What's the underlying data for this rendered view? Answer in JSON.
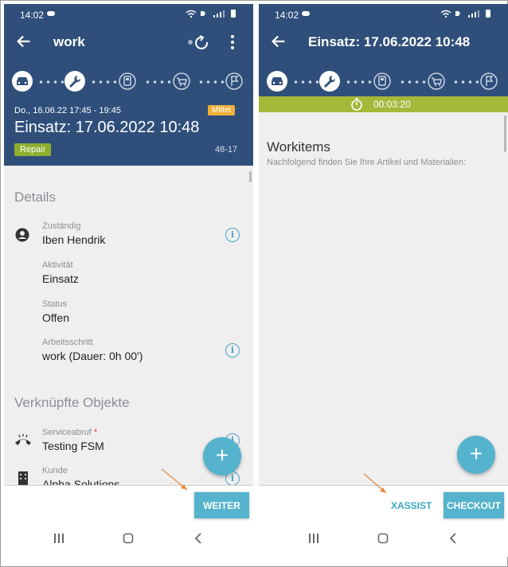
{
  "left": {
    "status": {
      "time": "14:02"
    },
    "appbar": {
      "title": "work"
    },
    "header": {
      "date_range": "Do., 16.06.22 17:45 - 19:45",
      "priority": "Mittel",
      "title": "Einsatz: 17.06.2022 10:48",
      "type_badge": "Repair",
      "code": "48-17"
    },
    "details": {
      "heading": "Details",
      "fields": [
        {
          "label": "Zuständig",
          "value": "Iben Hendrik"
        },
        {
          "label": "Aktivität",
          "value": "Einsatz"
        },
        {
          "label": "Status",
          "value": "Offen"
        },
        {
          "label": "Arbeitsschritt",
          "value": "work (Dauer: 0h 00')"
        }
      ]
    },
    "linked": {
      "heading": "Verknüpfte Objekte",
      "fields": [
        {
          "label": "Serviceabruf",
          "required_mark": "*",
          "value": "Testing FSM"
        },
        {
          "label": "Kunde",
          "value": "Alpha Solutions"
        }
      ]
    },
    "fab": "+",
    "actions": {
      "weiter": "WEITER"
    }
  },
  "right": {
    "status": {
      "time": "14:02"
    },
    "appbar": {
      "title": "Einsatz: 17.06.2022 10:48"
    },
    "timer": "00:03:20",
    "workitems": {
      "heading": "Workitems",
      "subtitle": "Nachfolgend finden Sie Ihre Artikel und Materialien:"
    },
    "fab": "+",
    "actions": {
      "xassist": "XASSIST",
      "checkout": "CHECKOUT"
    }
  },
  "colors": {
    "header_blue": "#2f4f7a",
    "accent_cyan": "#55b3cd",
    "priority_orange": "#f0b03a",
    "repair_green": "#8fae2f",
    "timer_green": "#a5b83a",
    "annotation_arrow": "#e58a3a"
  },
  "icons": [
    "car-icon",
    "wrench-icon",
    "device-icon",
    "cart-icon",
    "flag-icon",
    "sync-icon",
    "more-vert-icon",
    "back-arrow-icon",
    "person-icon",
    "phone-call-icon",
    "building-icon",
    "info-icon",
    "stopwatch-icon"
  ]
}
